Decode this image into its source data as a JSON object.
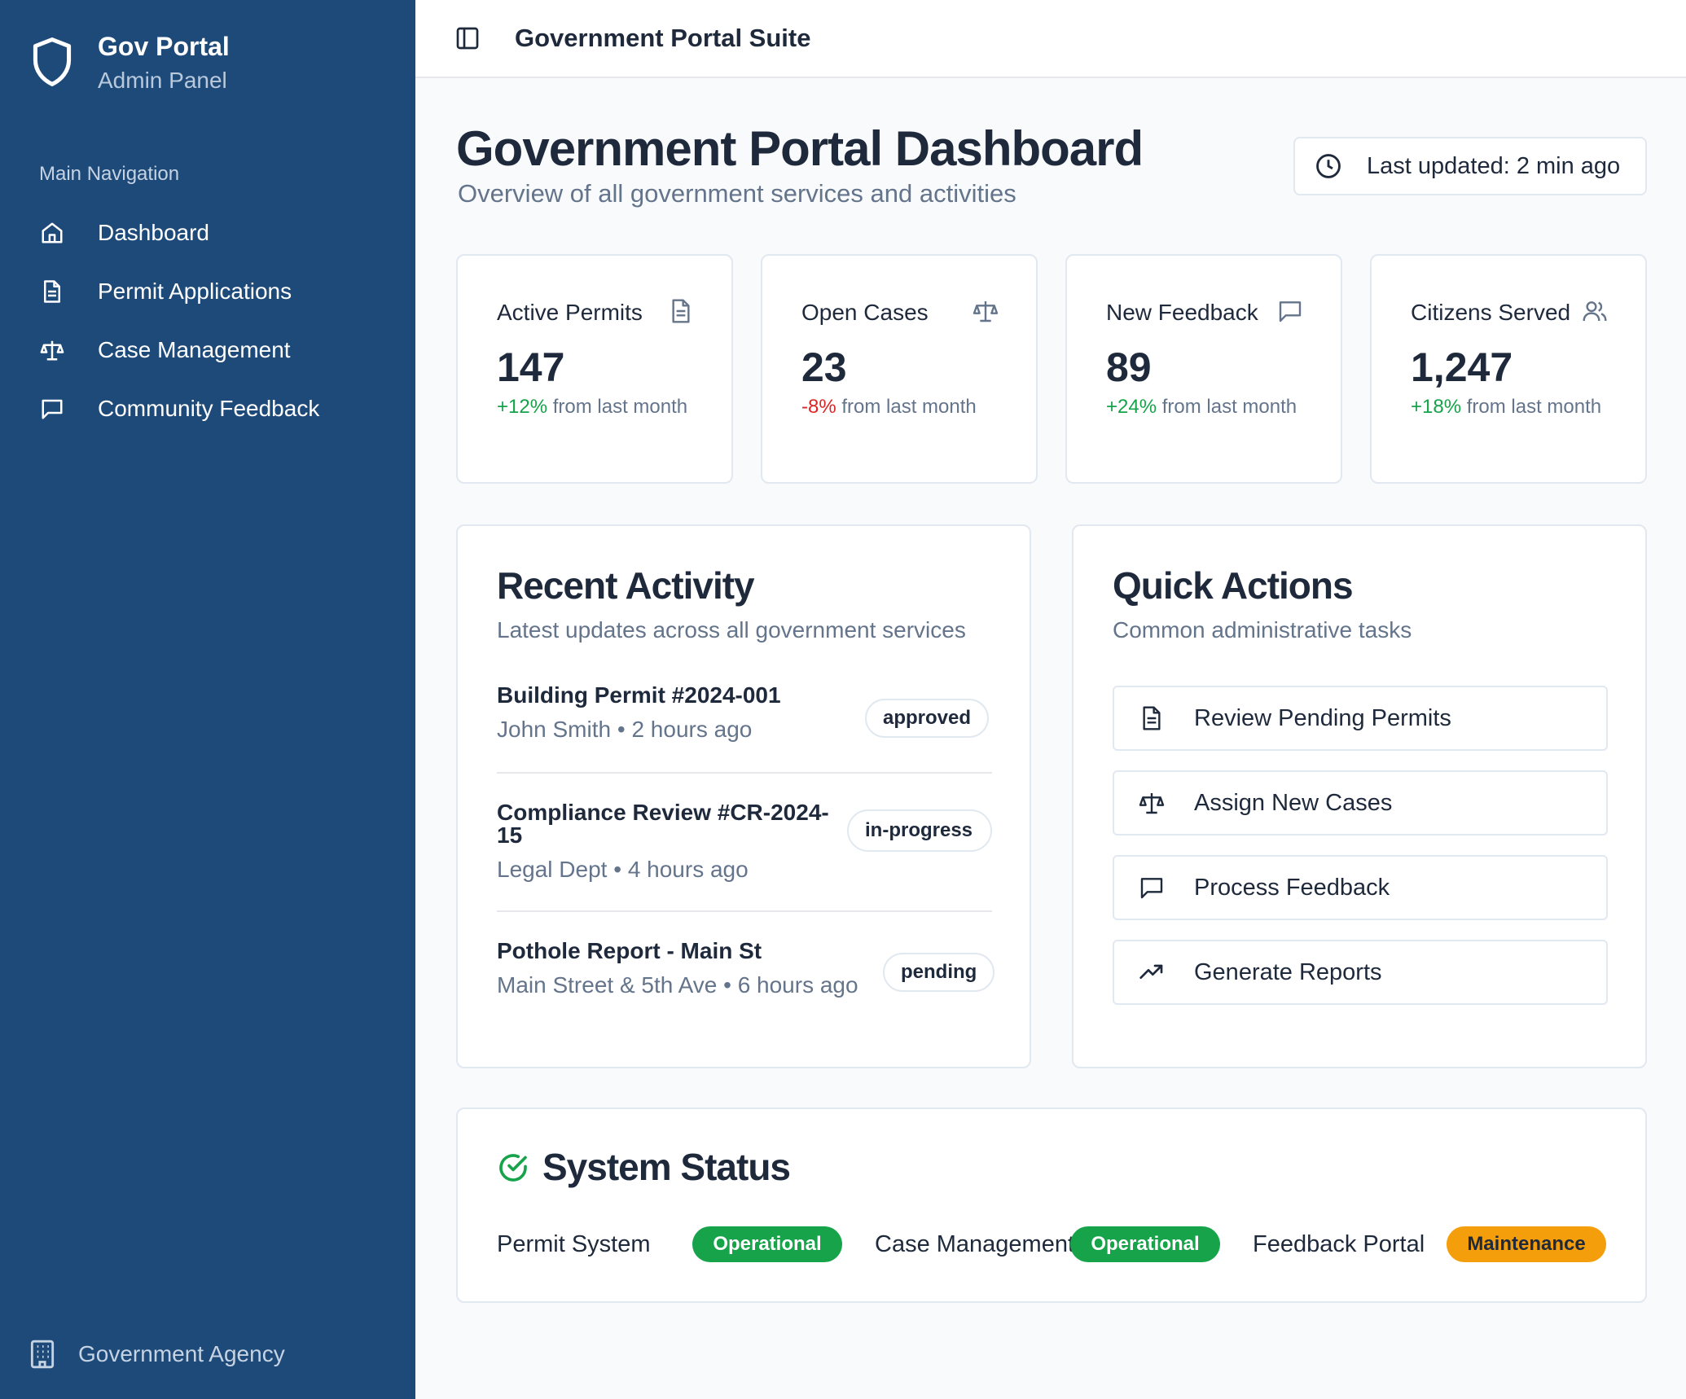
{
  "sidebar": {
    "brand_title": "Gov Portal",
    "brand_sub": "Admin Panel",
    "section_label": "Main Navigation",
    "items": [
      {
        "label": "Dashboard",
        "icon": "home-icon"
      },
      {
        "label": "Permit Applications",
        "icon": "file-text-icon"
      },
      {
        "label": "Case Management",
        "icon": "scale-icon"
      },
      {
        "label": "Community Feedback",
        "icon": "message-square-icon"
      }
    ],
    "footer": "Government Agency"
  },
  "topbar": {
    "title": "Government Portal Suite"
  },
  "header": {
    "title": "Government Portal Dashboard",
    "subtitle": "Overview of all government services and activities",
    "last_updated": "Last updated: 2 min ago"
  },
  "stats": [
    {
      "label": "Active Permits",
      "value": "147",
      "change": "+12%",
      "change_suffix": " from last month",
      "trend": "up"
    },
    {
      "label": "Open Cases",
      "value": "23",
      "change": "-8%",
      "change_suffix": " from last month",
      "trend": "down"
    },
    {
      "label": "New Feedback",
      "value": "89",
      "change": "+24%",
      "change_suffix": " from last month",
      "trend": "up"
    },
    {
      "label": "Citizens Served",
      "value": "1,247",
      "change": "+18%",
      "change_suffix": " from last month",
      "trend": "up"
    }
  ],
  "recent_activity": {
    "title": "Recent Activity",
    "subtitle": "Latest updates across all government services",
    "items": [
      {
        "title": "Building Permit #2024-001",
        "who": "John Smith",
        "when": "2 hours ago",
        "status": "approved"
      },
      {
        "title": "Compliance Review #CR-2024-15",
        "who": "Legal Dept",
        "when": "4 hours ago",
        "status": "in-progress"
      },
      {
        "title": "Pothole Report - Main St",
        "who": "Main Street & 5th Ave",
        "when": "6 hours ago",
        "status": "pending"
      }
    ]
  },
  "quick_actions": {
    "title": "Quick Actions",
    "subtitle": "Common administrative tasks",
    "items": [
      {
        "label": "Review Pending Permits",
        "icon": "file-text-icon"
      },
      {
        "label": "Assign New Cases",
        "icon": "scale-icon"
      },
      {
        "label": "Process Feedback",
        "icon": "message-square-icon"
      },
      {
        "label": "Generate Reports",
        "icon": "trending-up-icon"
      }
    ]
  },
  "system_status": {
    "title": "System Status",
    "items": [
      {
        "label": "Permit System",
        "status": "Operational"
      },
      {
        "label": "Case Management",
        "status": "Operational"
      },
      {
        "label": "Feedback Portal",
        "status": "Maintenance"
      }
    ]
  },
  "colors": {
    "sidebar_bg": "#1e4a7a",
    "positive": "#16a34a",
    "negative": "#dc2626",
    "operational": "#16a34a",
    "maintenance": "#f59e0b"
  }
}
